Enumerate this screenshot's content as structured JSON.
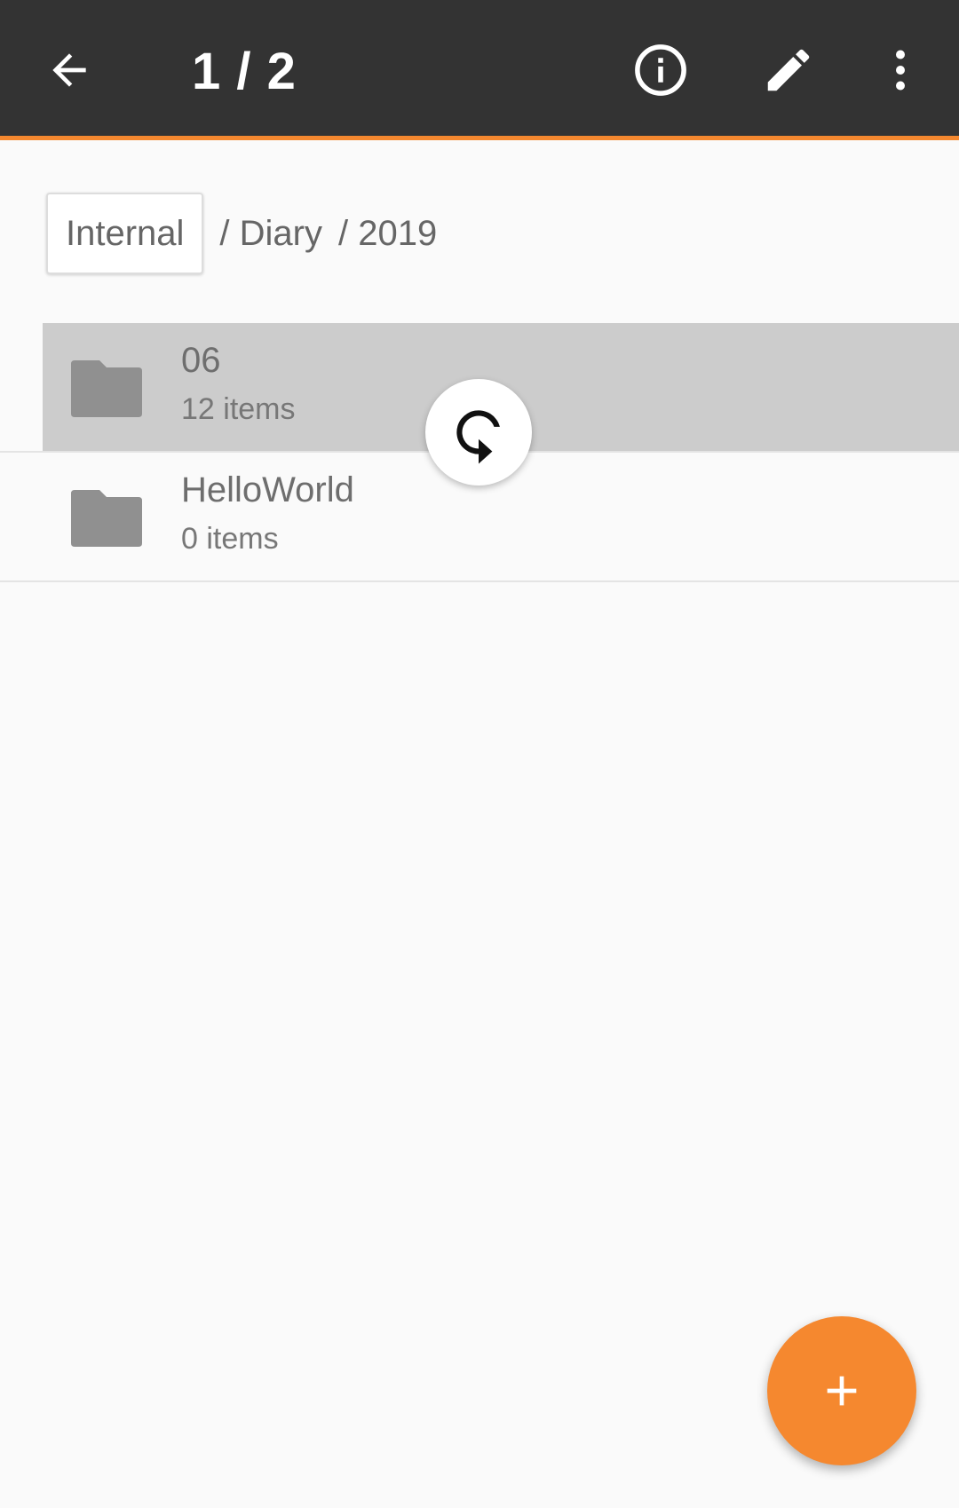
{
  "toolbar": {
    "title": "1 / 2",
    "back_icon": "arrow-back-icon",
    "actions": [
      {
        "icon": "info-icon"
      },
      {
        "icon": "pencil-edit-icon"
      },
      {
        "icon": "more-vert-icon"
      }
    ],
    "background_color": "#333333",
    "accent_color": "#f5882f"
  },
  "breadcrumb": {
    "root": "Internal",
    "items": [
      "/ Diary",
      "/ 2019"
    ]
  },
  "files": [
    {
      "name": "06",
      "subtitle": "12 items",
      "icon": "folder-icon",
      "selected": true
    },
    {
      "name": "HelloWorld",
      "subtitle": "0 items",
      "icon": "folder-icon",
      "selected": false
    }
  ],
  "refresh_indicator": {
    "icon": "refresh-icon"
  },
  "fab": {
    "icon": "plus-icon",
    "color": "#f5882f"
  }
}
